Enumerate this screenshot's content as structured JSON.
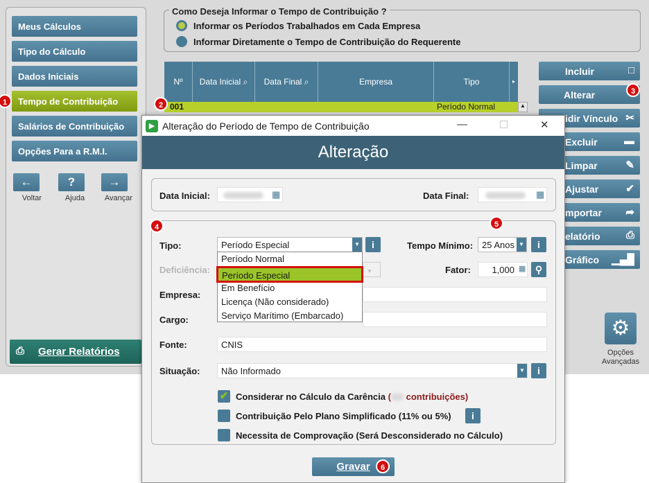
{
  "sidebar": {
    "items": [
      {
        "label": "Meus Cálculos"
      },
      {
        "label": "Tipo do Cálculo"
      },
      {
        "label": "Dados Iniciais"
      },
      {
        "label": "Tempo de Contribuição",
        "active": true
      },
      {
        "label": "Salários de Contribuição"
      },
      {
        "label": "Opções Para a R.M.I."
      }
    ],
    "nav": {
      "back_icon": "arrow-left",
      "back_label": "Voltar",
      "help_icon": "?",
      "help_label": "Ajuda",
      "forward_icon": "arrow-right",
      "forward_label": "Avançar"
    },
    "report_button": "Gerar Relatórios"
  },
  "question": {
    "title": "Como Deseja Informar o Tempo de Contribuição ?",
    "options": [
      {
        "label": "Informar os Períodos Trabalhados em Cada Empresa",
        "selected": true
      },
      {
        "label": "Informar Diretamente o Tempo de Contribuição do Requerente",
        "selected": false
      }
    ]
  },
  "grid": {
    "columns": [
      "Nº",
      "Data Inicial",
      "Data Final",
      "Empresa",
      "Tipo"
    ],
    "rows": [
      {
        "no": "001",
        "tipo": "Período Normal"
      }
    ]
  },
  "actions": [
    {
      "label": "Incluir",
      "icon": "square-icon"
    },
    {
      "label": "Alterar",
      "icon": "pencil-icon"
    },
    {
      "label": "Dividir Vínculo",
      "visible_label": "idir Vínculo",
      "icon": "scissors-icon"
    },
    {
      "label": "Excluir",
      "visible_label": "Excluir",
      "icon": "minus-icon"
    },
    {
      "label": "Limpar",
      "visible_label": "Limpar",
      "icon": "broom-icon"
    },
    {
      "label": "Ajustar",
      "visible_label": "Ajustar",
      "icon": "check-icon"
    },
    {
      "label": "Importar",
      "visible_label": "mportar",
      "icon": "import-icon"
    },
    {
      "label": "Relatório",
      "visible_label": "elatório",
      "icon": "printer-icon"
    },
    {
      "label": "Gráfico",
      "visible_label": "Gráfico",
      "icon": "bar-chart-icon"
    }
  ],
  "advanced_options": {
    "line1": "Opções",
    "line2": "Avançadas"
  },
  "badges": [
    "1",
    "2",
    "3",
    "4",
    "5",
    "6"
  ],
  "dialog": {
    "window_title": "Alteração do Período de Tempo de Contribuição",
    "banner": "Alteração",
    "data_inicial_label": "Data Inicial:",
    "data_final_label": "Data Final:",
    "tipo_label": "Tipo:",
    "tipo_value": "Período Especial",
    "tipo_options": [
      "Período Normal",
      "Período Especial",
      "Em Benefício",
      "Licença (Não considerado)",
      "Serviço Marítimo (Embarcado)"
    ],
    "tempo_minimo_label": "Tempo Mínimo:",
    "tempo_minimo_value": "25 Anos",
    "deficiencia_label": "Deficiência:",
    "fator_label": "Fator:",
    "fator_value": "1,000",
    "empresa_label": "Empresa:",
    "cargo_label": "Cargo:",
    "fonte_label": "Fonte:",
    "fonte_value": "CNIS",
    "situacao_label": "Situação:",
    "situacao_value": "Não Informado",
    "checks": [
      {
        "label_prefix": "Considerar no Cálculo da Carência",
        "label_suffix": "contribuições)",
        "checked": true
      },
      {
        "label": "Contribuição Pelo Plano Simplificado (11% ou 5%)",
        "checked": false
      },
      {
        "label": "Necessita de Comprovação (Será Desconsiderado no Cálculo)",
        "checked": false
      }
    ],
    "save_button": "Gravar"
  },
  "colors": {
    "accent": "#4a7b96",
    "active": "#9bb827",
    "dark_banner": "#3d6277",
    "badge": "#d40d0d"
  }
}
